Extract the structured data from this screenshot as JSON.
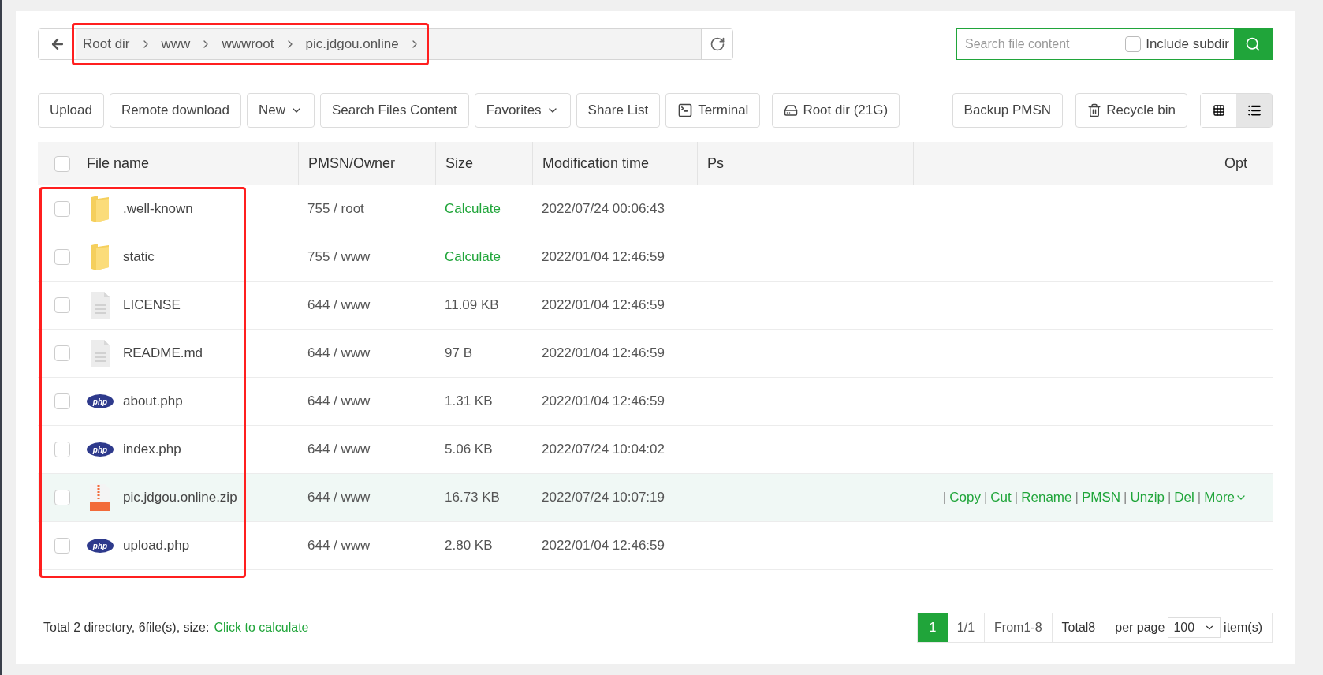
{
  "breadcrumb": {
    "highlighted": true,
    "items": [
      "Root dir",
      "www",
      "wwwroot",
      "pic.jdgou.online"
    ]
  },
  "search": {
    "placeholder": "Search file content",
    "include_subdir": {
      "label": "Include subdir",
      "checked": false
    }
  },
  "toolbar": [
    {
      "kind": "plain",
      "label": "Upload"
    },
    {
      "kind": "plain",
      "label": "Remote download"
    },
    {
      "kind": "dropdown",
      "label": "New"
    },
    {
      "kind": "plain",
      "label": "Search Files Content"
    },
    {
      "kind": "dropdown",
      "label": "Favorites"
    },
    {
      "kind": "plain",
      "label": "Share List"
    },
    {
      "kind": "terminal",
      "label": "Terminal"
    },
    {
      "kind": "disk",
      "label": "Root dir (21G)"
    }
  ],
  "toolbar_right": [
    {
      "kind": "plain",
      "label": "Backup PMSN"
    },
    {
      "kind": "trash",
      "label": "Recycle bin"
    }
  ],
  "view_modes": [
    {
      "kind": "grid",
      "selected": false
    },
    {
      "kind": "list",
      "selected": true
    }
  ],
  "table": {
    "name_column_highlighted": true,
    "select_all": false,
    "columns": [
      "File name",
      "PMSN/Owner",
      "Size",
      "Modification time",
      "Ps",
      "Opt"
    ],
    "rows": [
      {
        "kind": "folder",
        "name": ".well-known",
        "owner": "755 / root",
        "size": "Calculate",
        "size_is_link": true,
        "time": "2022/07/24 00:06:43",
        "checked": false,
        "hovered": false
      },
      {
        "kind": "folder",
        "name": "static",
        "owner": "755 / www",
        "size": "Calculate",
        "size_is_link": true,
        "time": "2022/01/04 12:46:59",
        "checked": false,
        "hovered": false
      },
      {
        "kind": "text",
        "name": "LICENSE",
        "owner": "644 / www",
        "size": "11.09 KB",
        "size_is_link": false,
        "time": "2022/01/04 12:46:59",
        "checked": false,
        "hovered": false
      },
      {
        "kind": "text",
        "name": "README.md",
        "owner": "644 / www",
        "size": "97 B",
        "size_is_link": false,
        "time": "2022/01/04 12:46:59",
        "checked": false,
        "hovered": false
      },
      {
        "kind": "php",
        "name": "about.php",
        "owner": "644 / www",
        "size": "1.31 KB",
        "size_is_link": false,
        "time": "2022/01/04 12:46:59",
        "checked": false,
        "hovered": false
      },
      {
        "kind": "php",
        "name": "index.php",
        "owner": "644 / www",
        "size": "5.06 KB",
        "size_is_link": false,
        "time": "2022/07/24 10:04:02",
        "checked": false,
        "hovered": false
      },
      {
        "kind": "zip",
        "name": "pic.jdgou.online.zip",
        "owner": "644 / www",
        "size": "16.73 KB",
        "size_is_link": false,
        "time": "2022/07/24 10:07:19",
        "checked": false,
        "hovered": true
      },
      {
        "kind": "php",
        "name": "upload.php",
        "owner": "644 / www",
        "size": "2.80 KB",
        "size_is_link": false,
        "time": "2022/01/04 12:46:59",
        "checked": false,
        "hovered": false
      }
    ],
    "row_actions": [
      "Copy",
      "Cut",
      "Rename",
      "PMSN",
      "Unzip",
      "Del",
      "More"
    ],
    "action_separator": "|"
  },
  "footer": {
    "summary": "Total 2 directory, 6file(s), size:",
    "calculate_link": "Click to calculate",
    "pages": [
      {
        "label": "1",
        "selected": true
      }
    ],
    "page_count": "1/1",
    "range": "From1-8",
    "total": "Total8",
    "per_page_label": "per page",
    "per_page": "100",
    "items_label": "item(s)"
  }
}
